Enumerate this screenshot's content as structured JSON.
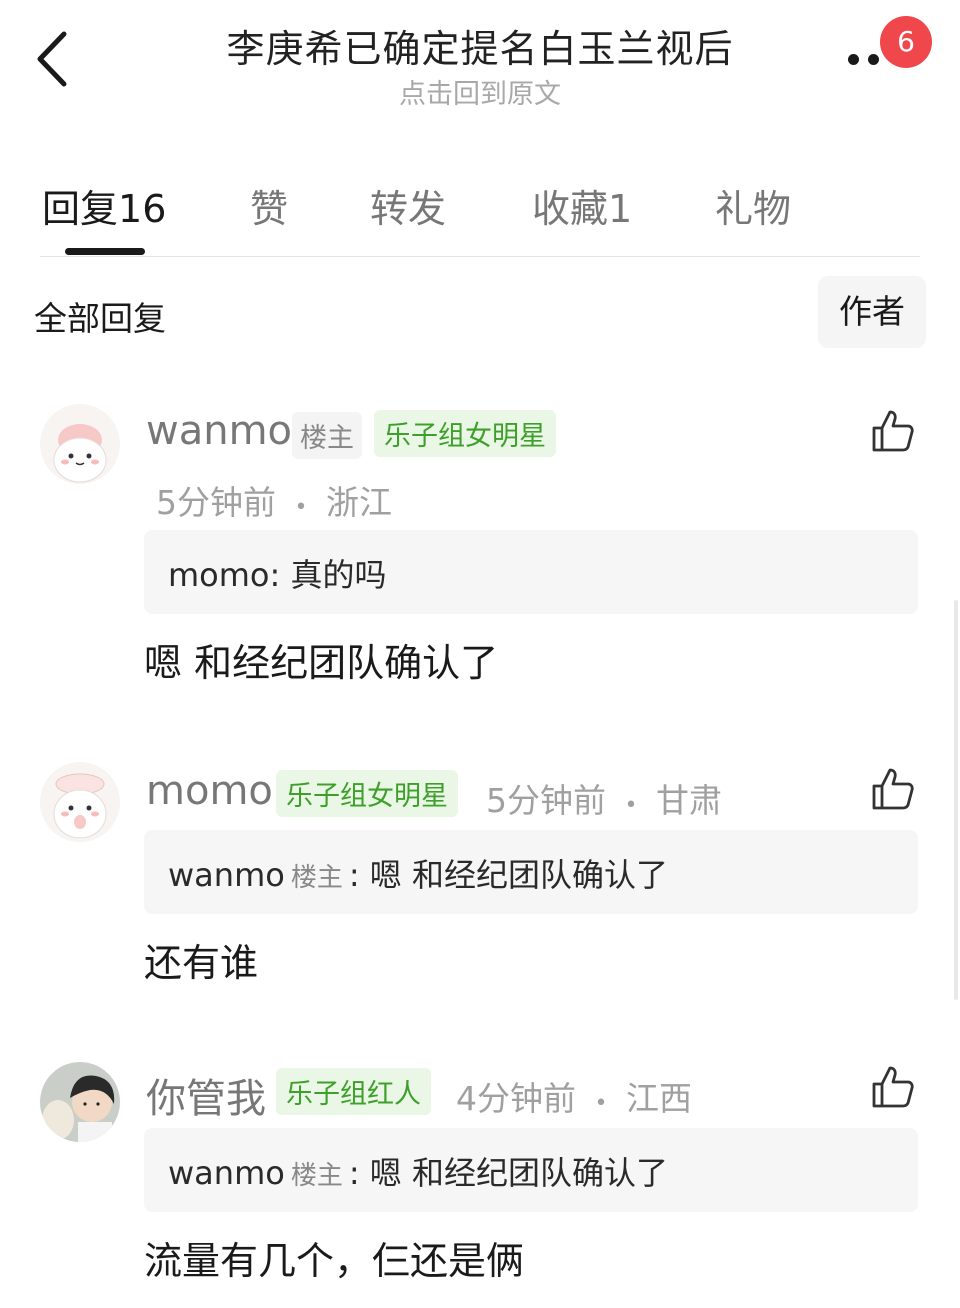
{
  "header": {
    "title": "李庚希已确定提名白玉兰视后",
    "subtitle": "点击回到原文",
    "badge_count": "6"
  },
  "tabs": [
    {
      "label": "回复",
      "count": "16"
    },
    {
      "label": "赞",
      "count": ""
    },
    {
      "label": "转发",
      "count": ""
    },
    {
      "label": "收藏",
      "count": "1"
    },
    {
      "label": "礼物",
      "count": ""
    }
  ],
  "filter": {
    "label": "全部回复",
    "author_button": "作者"
  },
  "comments": [
    {
      "name": "wanmo",
      "owner_tag": "楼主",
      "group_tag": "乐子组女明星",
      "time": "5分钟前",
      "location": "浙江",
      "quote_user": "momo:",
      "quote_owner": "",
      "quote_text": "真的吗",
      "text": "嗯 和经纪团队确认了"
    },
    {
      "name": "momo",
      "owner_tag": "",
      "group_tag": "乐子组女明星",
      "time": "5分钟前",
      "location": "甘肃",
      "quote_user": "wanmo",
      "quote_owner": "楼主",
      "quote_text": ": 嗯 和经纪团队确认了",
      "text": "还有谁"
    },
    {
      "name": "你管我",
      "owner_tag": "",
      "group_tag": "乐子组红人",
      "time": "4分钟前",
      "location": "江西",
      "quote_user": "wanmo",
      "quote_owner": "楼主",
      "quote_text": ": 嗯 和经纪团队确认了",
      "text": "流量有几个，仨还是俩"
    }
  ],
  "meta_separator": "•",
  "colors": {
    "badge": "#f0474c",
    "green_tag_text": "#3ea02b",
    "green_tag_bg": "#eaf7e6"
  }
}
